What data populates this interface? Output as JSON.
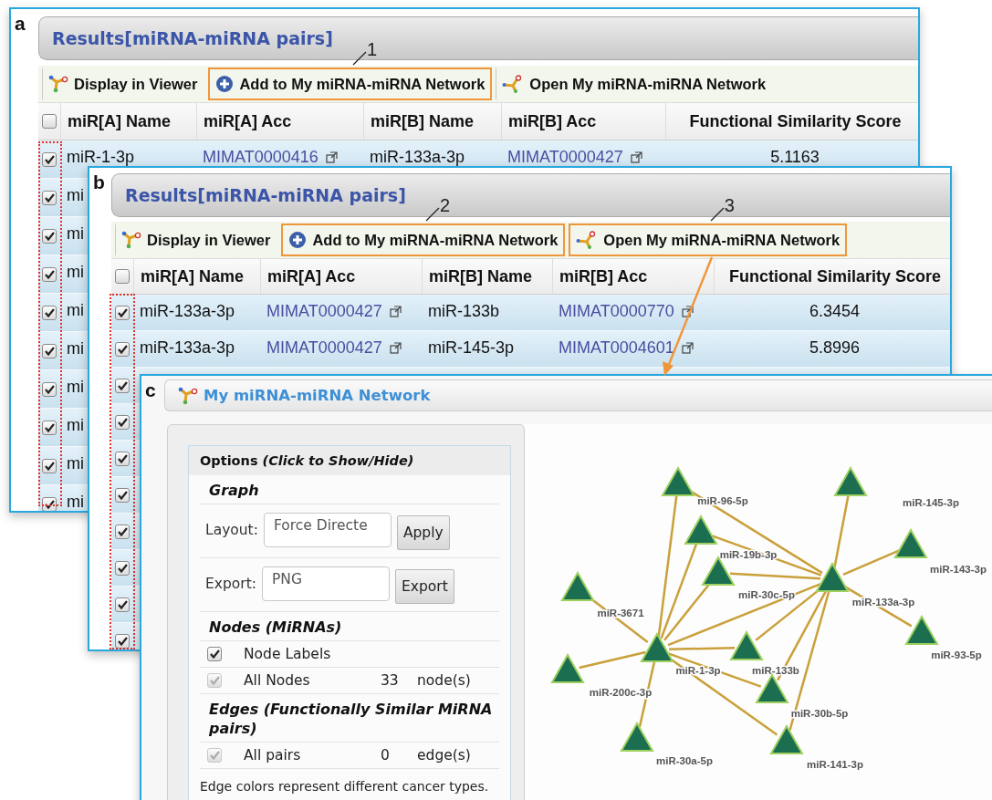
{
  "panel_a": {
    "label": "a",
    "title": "Results[miRNA-miRNA pairs]",
    "toolbar": [
      {
        "kind": "viewer",
        "label": "Display in Viewer",
        "highlighted": false
      },
      {
        "kind": "add",
        "label": "Add to My miRNA-miRNA Network",
        "highlighted": true,
        "callout": "1"
      },
      {
        "kind": "open",
        "label": "Open My miRNA-miRNA Network",
        "highlighted": false
      }
    ],
    "header_checked": false,
    "columns": [
      {
        "label": "miR[A] Name",
        "kind": "text"
      },
      {
        "label": "miR[A] Acc",
        "kind": "link"
      },
      {
        "label": "miR[B] Name",
        "kind": "text"
      },
      {
        "label": "miR[B] Acc",
        "kind": "link"
      },
      {
        "label": "Functional Similarity Score",
        "kind": "number"
      }
    ],
    "selection_outlined": true,
    "rows": [
      {
        "checked": true,
        "cells": [
          "miR-1-3p",
          "MIMAT0000416",
          "miR-133a-3p",
          "MIMAT0000427",
          "5.1163"
        ]
      },
      {
        "checked": true,
        "cells": [
          "mi"
        ]
      },
      {
        "checked": true,
        "cells": [
          "mi"
        ]
      },
      {
        "checked": true,
        "cells": [
          "mi"
        ]
      },
      {
        "checked": true,
        "cells": [
          "mi"
        ]
      },
      {
        "checked": true,
        "cells": [
          "mi"
        ]
      },
      {
        "checked": true,
        "cells": [
          "mi"
        ]
      },
      {
        "checked": true,
        "cells": [
          "mi"
        ]
      },
      {
        "checked": true,
        "cells": [
          "mi"
        ]
      },
      {
        "checked": true,
        "cells": [
          "mi"
        ]
      }
    ]
  },
  "panel_b": {
    "label": "b",
    "title": "Results[miRNA-miRNA pairs]",
    "toolbar": [
      {
        "kind": "viewer",
        "label": "Display in Viewer",
        "highlighted": false
      },
      {
        "kind": "add",
        "label": "Add to My miRNA-miRNA Network",
        "highlighted": true,
        "callout": "2"
      },
      {
        "kind": "open",
        "label": "Open My miRNA-miRNA Network",
        "highlighted": true,
        "callout": "3",
        "arrow": true
      }
    ],
    "header_checked": false,
    "columns": [
      {
        "label": "miR[A] Name",
        "kind": "text"
      },
      {
        "label": "miR[A] Acc",
        "kind": "link"
      },
      {
        "label": "miR[B] Name",
        "kind": "text"
      },
      {
        "label": "miR[B] Acc",
        "kind": "link"
      },
      {
        "label": "Functional Similarity Score",
        "kind": "number"
      }
    ],
    "selection_outlined": true,
    "rows": [
      {
        "checked": true,
        "cells": [
          "miR-133a-3p",
          "MIMAT0000427",
          "miR-133b",
          "MIMAT0000770",
          "6.3454"
        ]
      },
      {
        "checked": true,
        "cells": [
          "miR-133a-3p",
          "MIMAT0000427",
          "miR-145-3p",
          "MIMAT0004601",
          "5.8996"
        ]
      },
      {
        "checked": true
      },
      {
        "checked": true
      },
      {
        "checked": true
      },
      {
        "checked": true
      },
      {
        "checked": true
      },
      {
        "checked": true
      },
      {
        "checked": true
      },
      {
        "checked": true
      }
    ]
  },
  "panel_c": {
    "label": "c",
    "title": "My miRNA-miRNA Network",
    "options": {
      "heading": "Options *(Click to Show/Hide)*",
      "sections": [
        {
          "heading": "Graph",
          "rows": [
            {
              "kind": "select",
              "label": "Layout:",
              "value": "Force Directe",
              "button": "Apply"
            },
            {
              "kind": "select",
              "label": "Export:",
              "value": "PNG",
              "button": "Export"
            }
          ]
        },
        {
          "heading": "Nodes (MiRNAs)",
          "rows": [
            {
              "kind": "checkbox",
              "label": "Node Labels",
              "checked": true,
              "disabled": false
            },
            {
              "kind": "checkbox",
              "label": "All Nodes",
              "count": "33",
              "unit": "node(s)",
              "checked": true,
              "disabled": true
            }
          ]
        },
        {
          "heading": "Edges (Functionally Similar MiRNA pairs)",
          "rows": [
            {
              "kind": "checkbox",
              "label": "All pairs",
              "count": "0",
              "unit": "edge(s)",
              "checked": true,
              "disabled": true
            }
          ]
        }
      ],
      "note": "Edge colors represent different cancer types."
    },
    "network": {
      "nodes": [
        {
          "label": "miR-96-5p"
        },
        {
          "label": "miR-145-3p"
        },
        {
          "label": "miR-19b-3p"
        },
        {
          "label": "miR-143-3p"
        },
        {
          "label": "miR-30c-5p"
        },
        {
          "label": "miR-133a-3p"
        },
        {
          "label": "miR-3671"
        },
        {
          "label": "miR-93-5p"
        },
        {
          "label": "miR-1-3p"
        },
        {
          "label": "miR-133b"
        },
        {
          "label": "miR-200c-3p"
        },
        {
          "label": "miR-30b-5p"
        },
        {
          "label": "miR-30a-5p"
        },
        {
          "label": "miR-141-3p"
        }
      ]
    }
  }
}
